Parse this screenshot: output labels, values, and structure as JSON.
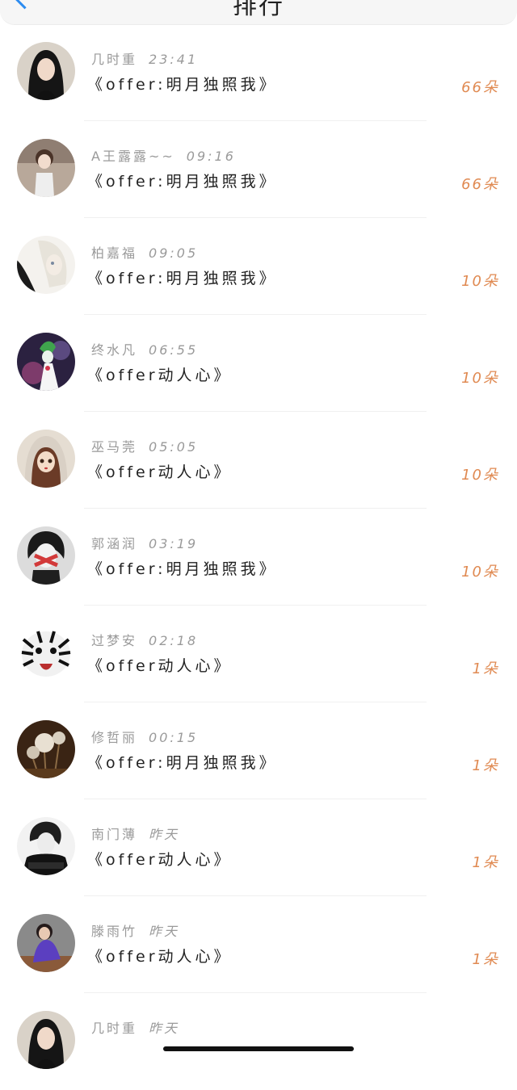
{
  "header": {
    "title": "排行"
  },
  "entries": [
    {
      "name": "几时重",
      "time": "23:41",
      "gift": "《offer:明月独照我》",
      "count": "66朵"
    },
    {
      "name": "A王露露~~",
      "time": "09:16",
      "gift": "《offer:明月独照我》",
      "count": "66朵"
    },
    {
      "name": "柏嘉福",
      "time": "09:05",
      "gift": "《offer:明月独照我》",
      "count": "10朵"
    },
    {
      "name": "终水凡",
      "time": "06:55",
      "gift": "《offer动人心》",
      "count": "10朵"
    },
    {
      "name": "巫马莞",
      "time": "05:05",
      "gift": "《offer动人心》",
      "count": "10朵"
    },
    {
      "name": "郭涵润",
      "time": "03:19",
      "gift": "《offer:明月独照我》",
      "count": "10朵"
    },
    {
      "name": "过梦安",
      "time": "02:18",
      "gift": "《offer动人心》",
      "count": "1朵"
    },
    {
      "name": "修哲丽",
      "time": "00:15",
      "gift": "《offer:明月独照我》",
      "count": "1朵"
    },
    {
      "name": "南门薄",
      "time": "昨天",
      "gift": "《offer动人心》",
      "count": "1朵"
    },
    {
      "name": "滕雨竹",
      "time": "昨天",
      "gift": "《offer动人心》",
      "count": "1朵"
    },
    {
      "name": "几时重",
      "time": "昨天",
      "gift": "",
      "count": ""
    }
  ],
  "colors": {
    "accent": "#e08a52",
    "back": "#2d8cf0"
  }
}
